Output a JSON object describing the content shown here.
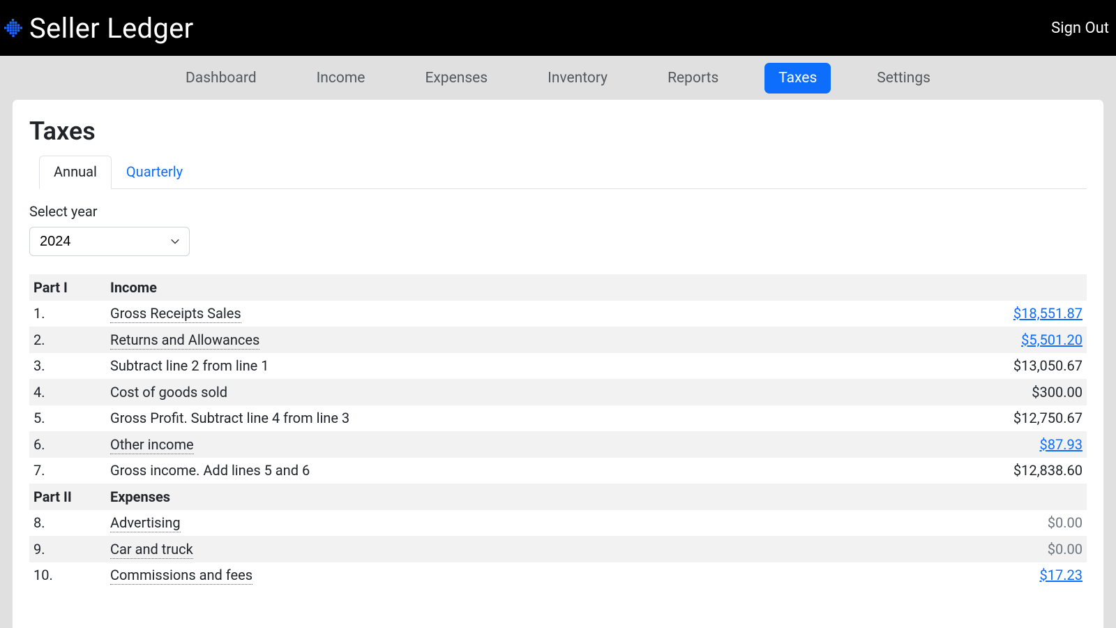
{
  "brand": "Seller Ledger",
  "signout": "Sign Out",
  "nav": {
    "items": [
      {
        "label": "Dashboard",
        "active": false
      },
      {
        "label": "Income",
        "active": false
      },
      {
        "label": "Expenses",
        "active": false
      },
      {
        "label": "Inventory",
        "active": false
      },
      {
        "label": "Reports",
        "active": false
      },
      {
        "label": "Taxes",
        "active": true
      },
      {
        "label": "Settings",
        "active": false
      }
    ]
  },
  "page": {
    "title": "Taxes",
    "tabs": [
      {
        "label": "Annual",
        "active": true
      },
      {
        "label": "Quarterly",
        "active": false
      }
    ],
    "select_label": "Select year",
    "selected_year": "2024"
  },
  "sections": [
    {
      "part": "Part I",
      "title": "Income"
    },
    {
      "part": "Part II",
      "title": "Expenses"
    }
  ],
  "rows": [
    {
      "num": "1.",
      "label": "Gross Receipts Sales",
      "amount": "$18,551.87",
      "label_dotted": true,
      "amount_link": true
    },
    {
      "num": "2.",
      "label": "Returns and Allowances",
      "amount": "$5,501.20",
      "label_dotted": true,
      "amount_link": true
    },
    {
      "num": "3.",
      "label": "Subtract line 2 from line 1",
      "amount": "$13,050.67",
      "label_dotted": false,
      "amount_link": false
    },
    {
      "num": "4.",
      "label": "Cost of goods sold",
      "amount": "$300.00",
      "label_dotted": false,
      "amount_link": false
    },
    {
      "num": "5.",
      "label": "Gross Profit. Subtract line 4 from line 3",
      "amount": "$12,750.67",
      "label_dotted": false,
      "amount_link": false
    },
    {
      "num": "6.",
      "label": "Other income",
      "amount": "$87.93",
      "label_dotted": true,
      "amount_link": true
    },
    {
      "num": "7.",
      "label": "Gross income. Add lines 5 and 6",
      "amount": "$12,838.60",
      "label_dotted": false,
      "amount_link": false
    },
    {
      "num": "8.",
      "label": "Advertising",
      "amount": "$0.00",
      "label_dotted": true,
      "amount_link": false,
      "amount_muted": true
    },
    {
      "num": "9.",
      "label": "Car and truck",
      "amount": "$0.00",
      "label_dotted": true,
      "amount_link": false,
      "amount_muted": true
    },
    {
      "num": "10.",
      "label": "Commissions and fees",
      "amount": "$17.23",
      "label_dotted": true,
      "amount_link": true
    }
  ]
}
